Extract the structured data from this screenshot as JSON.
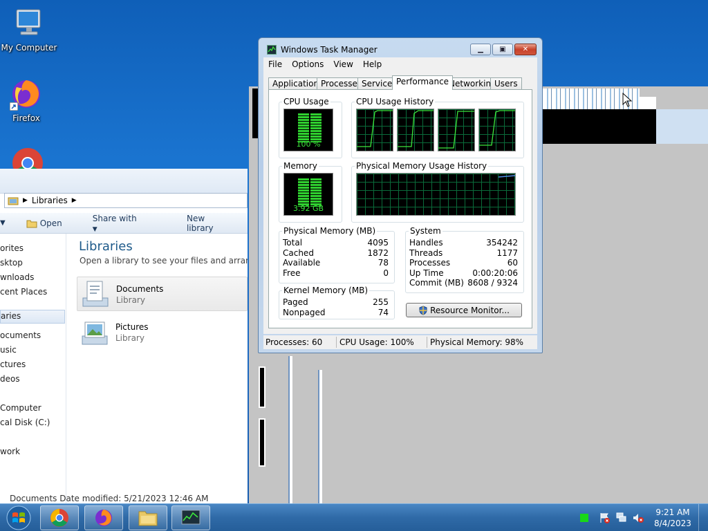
{
  "desktop": {
    "icons": [
      {
        "label": "My Computer"
      },
      {
        "label": "Firefox"
      }
    ]
  },
  "explorer": {
    "breadcrumb": "Libraries",
    "toolbar": {
      "open": "Open",
      "share_with": "Share with",
      "new_library": "New library"
    },
    "nav": [
      "orites",
      "sktop",
      "wnloads",
      "cent Places",
      "aries",
      "ocuments",
      "usic",
      "ctures",
      "deos",
      "Computer",
      "cal Disk (C:)",
      "work"
    ],
    "title": "Libraries",
    "subtitle": "Open a library to see your files and arrange the",
    "items": [
      {
        "name": "Documents",
        "kind": "Library"
      },
      {
        "name": "Pictures",
        "kind": "Library"
      }
    ],
    "status": "Documents   Date modified: 5/21/2023 12:46 AM"
  },
  "taskmgr": {
    "title": "Windows Task Manager",
    "menu": [
      "File",
      "Options",
      "View",
      "Help"
    ],
    "tabs": [
      "Applications",
      "Processes",
      "Services",
      "Performance",
      "Networking",
      "Users"
    ],
    "active_tab": "Performance",
    "cpu_usage": {
      "label": "CPU Usage",
      "value": "100 %",
      "level_pct": 100
    },
    "cpu_history": {
      "label": "CPU Usage History"
    },
    "memory": {
      "label": "Memory",
      "value": "3.92 GB",
      "level_pct": 98
    },
    "memory_history": {
      "label": "Physical Memory Usage History"
    },
    "physical_memory": {
      "label": "Physical Memory (MB)",
      "rows": [
        {
          "k": "Total",
          "v": "4095"
        },
        {
          "k": "Cached",
          "v": "1872"
        },
        {
          "k": "Available",
          "v": "78"
        },
        {
          "k": "Free",
          "v": "0"
        }
      ]
    },
    "kernel_memory": {
      "label": "Kernel Memory (MB)",
      "rows": [
        {
          "k": "Paged",
          "v": "255"
        },
        {
          "k": "Nonpaged",
          "v": "74"
        }
      ]
    },
    "system": {
      "label": "System",
      "rows": [
        {
          "k": "Handles",
          "v": "354242"
        },
        {
          "k": "Threads",
          "v": "1177"
        },
        {
          "k": "Processes",
          "v": "60"
        },
        {
          "k": "Up Time",
          "v": "0:00:20:06"
        },
        {
          "k": "Commit (MB)",
          "v": "8608 / 9324"
        }
      ]
    },
    "resource_monitor": "Resource Monitor...",
    "status": {
      "processes": "Processes: 60",
      "cpu": "CPU Usage: 100%",
      "memory": "Physical Memory: 98%"
    }
  },
  "taskbar": {
    "time": "9:21 AM",
    "date": "8/4/2023"
  },
  "colors": {
    "meter_green": "#2fd02f",
    "graph_grid": "#0a6b3a",
    "graph_line": "#3ce63c",
    "accent": "#1e5a8a"
  }
}
